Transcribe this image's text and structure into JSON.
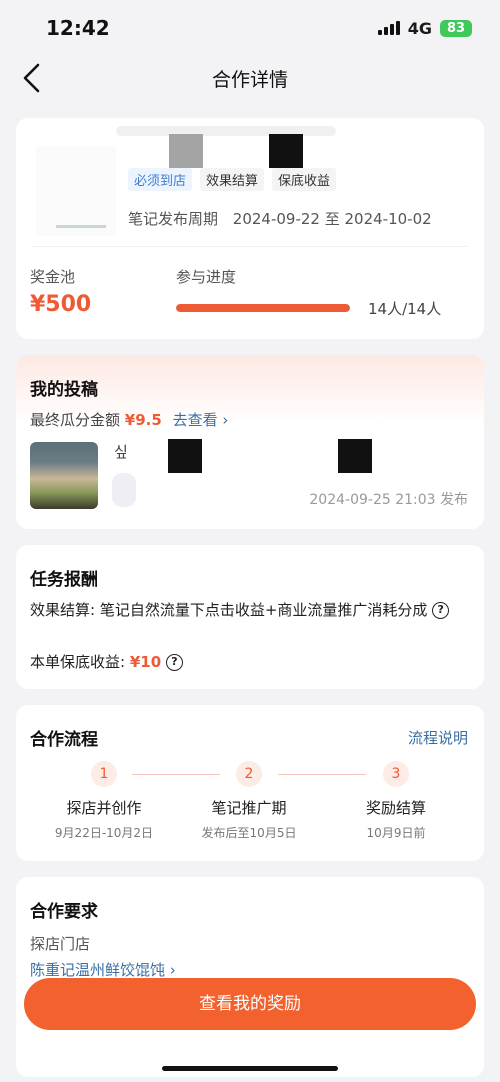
{
  "status_bar": {
    "time": "12:42",
    "network": "4G",
    "battery": "83"
  },
  "nav": {
    "title": "合作详情"
  },
  "campaign": {
    "tags": [
      "必须到店",
      "效果结算",
      "保底收益"
    ],
    "period_label": "笔记发布周期",
    "period_dates": "2024-09-22 至 2024-10-02",
    "pool_label": "奖金池",
    "pool_value": "¥500",
    "progress_label": "参与进度",
    "progress_count": "14人/14人",
    "progress_fraction": 1.0
  },
  "submission": {
    "title": "我的投稿",
    "final_label": "最终瓜分金额",
    "final_amount": "¥9.5",
    "view_link": "去查看 ›",
    "note_title": "싶",
    "publish_time": "2024-09-25 21:03 发布"
  },
  "reward": {
    "title": "任务报酬",
    "settlement": "效果结算: 笔记自然流量下点击收益+商业流量推广消耗分成",
    "guarantee_label": "本单保底收益:",
    "guarantee_value": "¥10"
  },
  "flow": {
    "title": "合作流程",
    "explain_link": "流程说明",
    "steps": [
      {
        "num": "1",
        "name": "探店并创作",
        "date": "9月22日-10月2日"
      },
      {
        "num": "2",
        "name": "笔记推广期",
        "date": "发布后至10月5日"
      },
      {
        "num": "3",
        "name": "奖励结算",
        "date": "10月9日前"
      }
    ]
  },
  "requirements": {
    "title": "合作要求",
    "store_label": "探店门店",
    "store_name": "陈重记温州鲜饺馄饨 ›"
  },
  "cta": {
    "label": "查看我的奖励"
  },
  "colors": {
    "accent": "#ee5a34",
    "link": "#3b6ea5",
    "background": "#f3f3f5"
  }
}
